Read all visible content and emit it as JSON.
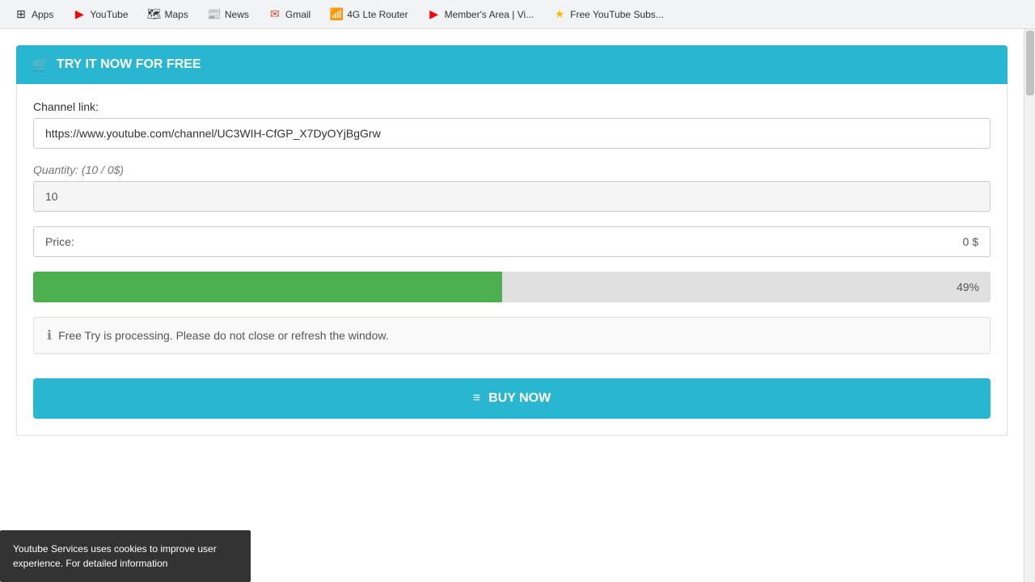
{
  "browser": {
    "tabs": [
      {
        "id": "apps",
        "label": "Apps",
        "icon": "⊞",
        "iconColor": "#555"
      },
      {
        "id": "youtube",
        "label": "YouTube",
        "icon": "▶",
        "iconColor": "#ff0000"
      },
      {
        "id": "maps",
        "label": "Maps",
        "icon": "📍",
        "iconColor": "#34a853"
      },
      {
        "id": "news",
        "label": "News",
        "icon": "📰",
        "iconColor": "#4285f4"
      },
      {
        "id": "gmail",
        "label": "Gmail",
        "icon": "✉",
        "iconColor": "#ea4335"
      },
      {
        "id": "4glte",
        "label": "4G Lte Router",
        "icon": "📶",
        "iconColor": "#555"
      },
      {
        "id": "members",
        "label": "Member's Area | Vi...",
        "icon": "▶",
        "iconColor": "#ff0000"
      },
      {
        "id": "freesubs",
        "label": "Free YouTube Subs...",
        "icon": "🌟",
        "iconColor": "#fbbc05"
      }
    ]
  },
  "page": {
    "header": {
      "icon": "🛒",
      "title": "TRY IT NOW FOR FREE"
    },
    "form": {
      "channel_label": "Channel link:",
      "channel_value": "https://www.youtube.com/channel/UC3WIH-CfGP_X7DyOYjBgGrw",
      "quantity_label": "Quantity:",
      "quantity_hint": "(10 / 0$)",
      "quantity_value": "10",
      "price_label": "Price:",
      "price_value": "0 $",
      "progress_percent": "49%",
      "progress_width": "49%",
      "info_message": "Free Try is processing. Please do not close or refresh the window.",
      "buy_button_label": "BUY NOW"
    },
    "cookie_banner": {
      "text": "Youtube Services uses cookies to improve user experience. For detailed information"
    }
  }
}
